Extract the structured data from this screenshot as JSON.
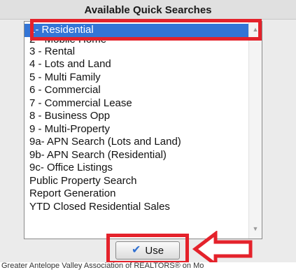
{
  "panel": {
    "title": "Available Quick Searches"
  },
  "list": {
    "items": [
      {
        "label": "1- Residential"
      },
      {
        "label": "2 - Mobile Home"
      },
      {
        "label": "3 - Rental"
      },
      {
        "label": "4 - Lots and Land"
      },
      {
        "label": "5 - Multi Family"
      },
      {
        "label": "6 - Commercial"
      },
      {
        "label": "7 - Commercial Lease"
      },
      {
        "label": "8 - Business Opp"
      },
      {
        "label": "9 - Multi-Property"
      },
      {
        "label": "9a- APN Search (Lots and Land)"
      },
      {
        "label": "9b- APN Search (Residential)"
      },
      {
        "label": "9c- Office Listings"
      },
      {
        "label": "Public Property Search"
      },
      {
        "label": "Report Generation"
      },
      {
        "label": "YTD Closed Residential Sales"
      }
    ],
    "selected": "1- Residential",
    "scroll_up_glyph": "▲",
    "scroll_down_glyph": "▼"
  },
  "button": {
    "label": "Use",
    "icon_glyph": "✔"
  },
  "footer": {
    "text": "Greater Antelope Valley Association of REALTORS® on Mo"
  },
  "colors": {
    "selection": "#3375d6",
    "annotation": "#e4222b",
    "check_icon": "#2f6fd1"
  }
}
